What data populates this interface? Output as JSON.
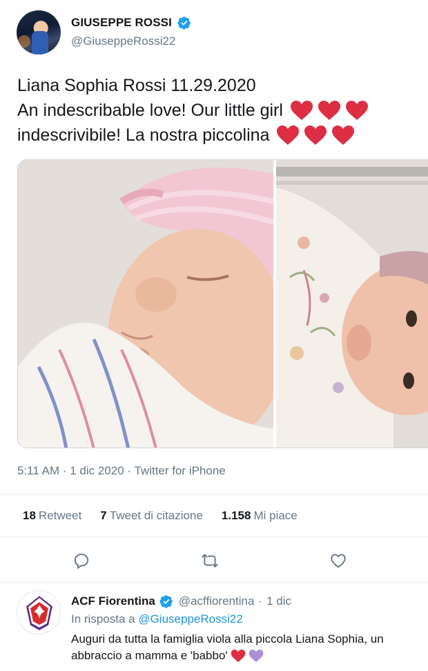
{
  "tweet": {
    "author": {
      "display_name": "GIUSEPPE ROSSI",
      "handle": "@GiuseppeRossi22",
      "verified": true
    },
    "text_lines": [
      "Liana Sophia Rossi 11.29.2020",
      "An indescribable love! Our little girl",
      "indescrivibile! La nostra piccolina"
    ],
    "meta": "5:11 AM · 1 dic 2020 · Twitter for iPhone",
    "stats": {
      "retweets_count": "18",
      "retweets_label": "Retweet",
      "quotes_count": "7",
      "quotes_label": "Tweet di citazione",
      "likes_count": "1.158",
      "likes_label": "Mi piace"
    },
    "actions": [
      "reply-icon",
      "retweet-icon",
      "like-icon"
    ],
    "accent": "#1da1f2",
    "heart_color": "#e0245e"
  },
  "reply": {
    "display_name": "ACF Fiorentina",
    "handle": "@acffiorentina",
    "time": "1 dic",
    "reply_prefix": "In risposta a",
    "reply_handle": "@GiuseppeRossi22",
    "text_line1": "Auguri da tutta la famiglia viola alla piccola Liana Sophia, un",
    "text_line2": "abbraccio a mamma e 'babbo'",
    "logo_color": "#5b2a86"
  }
}
